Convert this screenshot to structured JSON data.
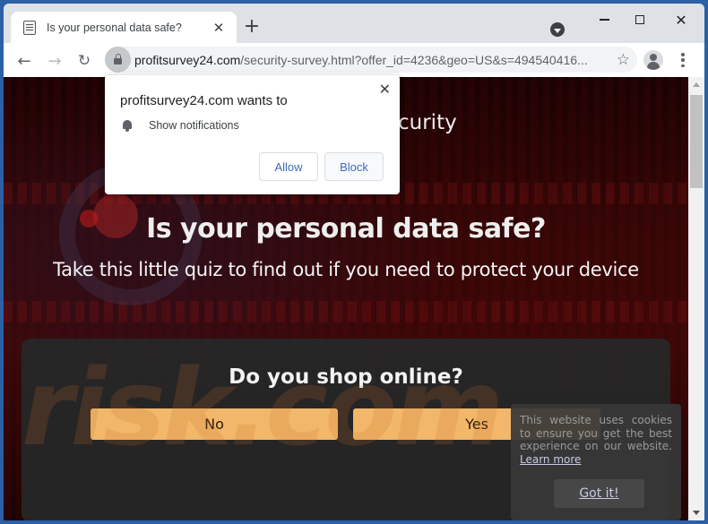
{
  "browser": {
    "tab": {
      "title": "Is your personal data safe?",
      "favicon": "document-icon",
      "close_glyph": "✕"
    },
    "new_tab_glyph": "+",
    "window_controls": {
      "close_glyph": "✕"
    },
    "toolbar": {
      "back_glyph": "←",
      "forward_glyph": "→",
      "reload_glyph": "↻",
      "url_domain": "profitsurvey24.com",
      "url_path": "/security-survey.html?offer_id=4236&geo=US&s=494540416...",
      "star_glyph": "☆"
    }
  },
  "permission_prompt": {
    "title": "profitsurvey24.com wants to",
    "permission": "Show notifications",
    "allow_label": "Allow",
    "block_label": "Block",
    "close_glyph": "✕"
  },
  "page": {
    "header_partial": "curity",
    "title": "Is your personal data safe?",
    "subtitle": "Take this little quiz to find out if you need to protect your device",
    "quiz": {
      "question": "Do you shop online?",
      "options": [
        "No",
        "Yes"
      ]
    },
    "watermark": "risk.com",
    "cookie_banner": {
      "text": "This website uses cookies to ensure you get the best experience on our website.",
      "learn_more": "Learn more",
      "button": "Got it!"
    }
  },
  "colors": {
    "quiz_button": "#f2b76a",
    "link": "#c8cbe6",
    "background_red": "#3a0707",
    "prompt_button_text": "#3f6ab5"
  }
}
